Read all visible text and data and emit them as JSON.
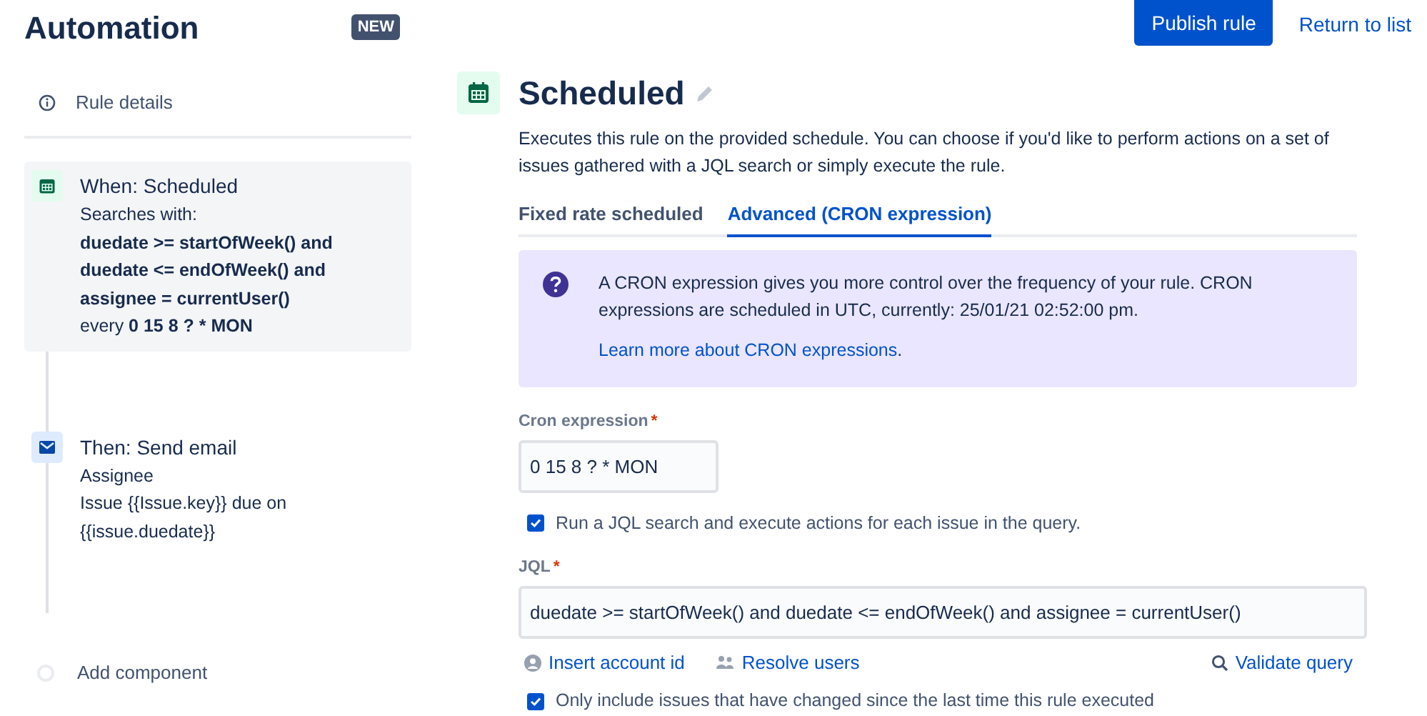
{
  "header": {
    "title": "Automation",
    "badge": "NEW"
  },
  "sidebar": {
    "rule_details": "Rule details",
    "components": [
      {
        "kind": "trigger",
        "selected": true,
        "title": "When: Scheduled",
        "lines": [
          {
            "text": "Searches with:",
            "bold": false
          },
          {
            "text": "duedate >= startOfWeek() and",
            "bold": true
          },
          {
            "text": "duedate <= endOfWeek() and",
            "bold": true
          },
          {
            "text": "assignee = currentUser()",
            "bold": true
          },
          {
            "text": "every **0 15 8 ? * MON**",
            "bold": false
          }
        ]
      },
      {
        "kind": "action",
        "selected": false,
        "title": "Then: Send email",
        "lines": [
          {
            "text": "Assignee",
            "bold": false
          },
          {
            "text": "Issue {{Issue.key}} due on {{issue.duedate}}",
            "bold": false
          }
        ]
      }
    ],
    "add_component": "Add component"
  },
  "toolbar": {
    "publish": "Publish rule",
    "return": "Return to list"
  },
  "panel": {
    "title": "Scheduled",
    "description": "Executes this rule on the provided schedule. You can choose if you'd like to perform actions on a set of issues gathered with a JQL search or simply execute the rule.",
    "tabs": [
      {
        "label": "Fixed rate scheduled",
        "selected": false
      },
      {
        "label": "Advanced (CRON expression)",
        "selected": true
      }
    ],
    "info": {
      "text": "A CRON expression gives you more control over the frequency of your rule. CRON expressions are scheduled in UTC, currently: 25/01/21 02:52:00 pm.",
      "link": "Learn more about CRON expressions",
      "link_suffix": "."
    },
    "cron": {
      "label": "Cron expression",
      "required": "*",
      "value": "0 15 8 ? * MON"
    },
    "run_jql": {
      "label": "Run a JQL search and execute actions for each issue in the query.",
      "checked": true
    },
    "jql": {
      "label": "JQL",
      "required": "*",
      "value": "duedate >= startOfWeek() and duedate <= endOfWeek() and assignee = currentUser()"
    },
    "jql_links": [
      {
        "kind": "account",
        "label": "Insert account id"
      },
      {
        "kind": "users",
        "label": "Resolve users"
      },
      {
        "kind": "validate",
        "label": "Validate query"
      }
    ],
    "only_changed": {
      "label": "Only include issues that have changed since the last time this rule executed",
      "checked": true
    }
  }
}
